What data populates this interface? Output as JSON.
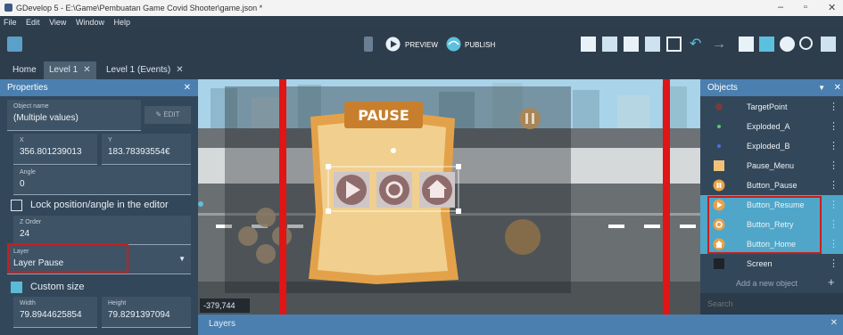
{
  "window": {
    "title": "GDevelop 5 - E:\\Game\\Pembuatan Game Covid Shooter\\game.json *"
  },
  "menu": [
    "File",
    "Edit",
    "View",
    "Window",
    "Help"
  ],
  "toolbar": {
    "preview_label": "PREVIEW",
    "publish_label": "PUBLISH"
  },
  "tabs": [
    {
      "label": "Home",
      "closable": false
    },
    {
      "label": "Level 1",
      "closable": true
    },
    {
      "label": "Level 1 (Events)",
      "closable": true
    }
  ],
  "properties": {
    "title": "Properties",
    "object_name_label": "Object name",
    "object_name_value": "(Multiple values)",
    "edit_label": "EDIT",
    "x_label": "X",
    "x_value": "356.801239013",
    "y_label": "Y",
    "y_value": "183.78393554€",
    "angle_label": "Angle",
    "angle_value": "0",
    "lock_label": "Lock position/angle in the editor",
    "zorder_label": "Z Order",
    "zorder_value": "24",
    "layer_label": "Layer",
    "layer_value": "Layer Pause",
    "custom_size_label": "Custom size",
    "width_label": "Width",
    "width_value": "79.8944625854",
    "height_label": "Height",
    "height_value": "79.8291397094"
  },
  "scene": {
    "pause_title": "PAUSE",
    "coords": "-379,744"
  },
  "objects": {
    "title": "Objects",
    "items": [
      {
        "name": "TargetPoint",
        "icon": "targetpoint-icon"
      },
      {
        "name": "Exploded_A",
        "icon": "green-dot-icon"
      },
      {
        "name": "Exploded_B",
        "icon": "blue-dot-icon"
      },
      {
        "name": "Pause_Menu",
        "icon": "pause-menu-icon"
      },
      {
        "name": "Button_Pause",
        "icon": "pause-button-icon"
      },
      {
        "name": "Button_Resume",
        "icon": "resume-button-icon"
      },
      {
        "name": "Button_Retry",
        "icon": "retry-button-icon"
      },
      {
        "name": "Button_Home",
        "icon": "home-button-icon"
      },
      {
        "name": "Screen",
        "icon": "screen-icon"
      }
    ],
    "add_label": "Add a new object",
    "search_placeholder": "Search"
  },
  "layers": {
    "title": "Layers"
  },
  "colors": {
    "accent": "#4a7fb0",
    "highlight": "#c81e1e",
    "selected_row": "#4fa6c9"
  }
}
